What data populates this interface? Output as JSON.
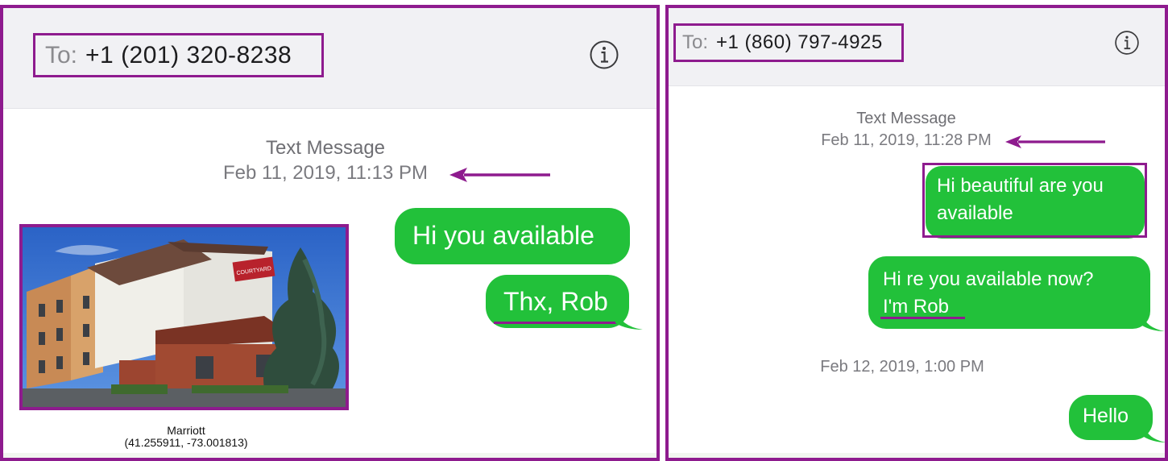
{
  "colors": {
    "accent": "#8e1b8e",
    "bubble": "#22c13a",
    "header": "#f1f1f4",
    "timestamp": "#7a7a7f"
  },
  "left": {
    "header": {
      "to_label": "To:",
      "number": "+1 (201) 320-8238",
      "info_icon": "info-circle-icon"
    },
    "timestamp": {
      "service": "Text Message",
      "datetime": "Feb 11, 2019, 11:13 PM"
    },
    "messages": [
      {
        "text": "Hi you available"
      },
      {
        "text": "Thx, Rob"
      }
    ],
    "photo": {
      "caption_title": "Marriott",
      "caption_coords": "(41.255911, -73.001813)"
    }
  },
  "right": {
    "header": {
      "to_label": "To:",
      "number": "+1 (860) 797-4925",
      "info_icon": "info-circle-icon"
    },
    "timestamp": {
      "service": "Text Message",
      "datetime": "Feb 11, 2019, 11:28 PM"
    },
    "messages": [
      {
        "line1": "Hi beautiful are you",
        "line2": "available"
      },
      {
        "line1": "Hi re you available now?",
        "line2": "I'm Rob"
      }
    ],
    "timestamp2": "Feb 12, 2019, 1:00 PM",
    "message3": "Hello"
  }
}
